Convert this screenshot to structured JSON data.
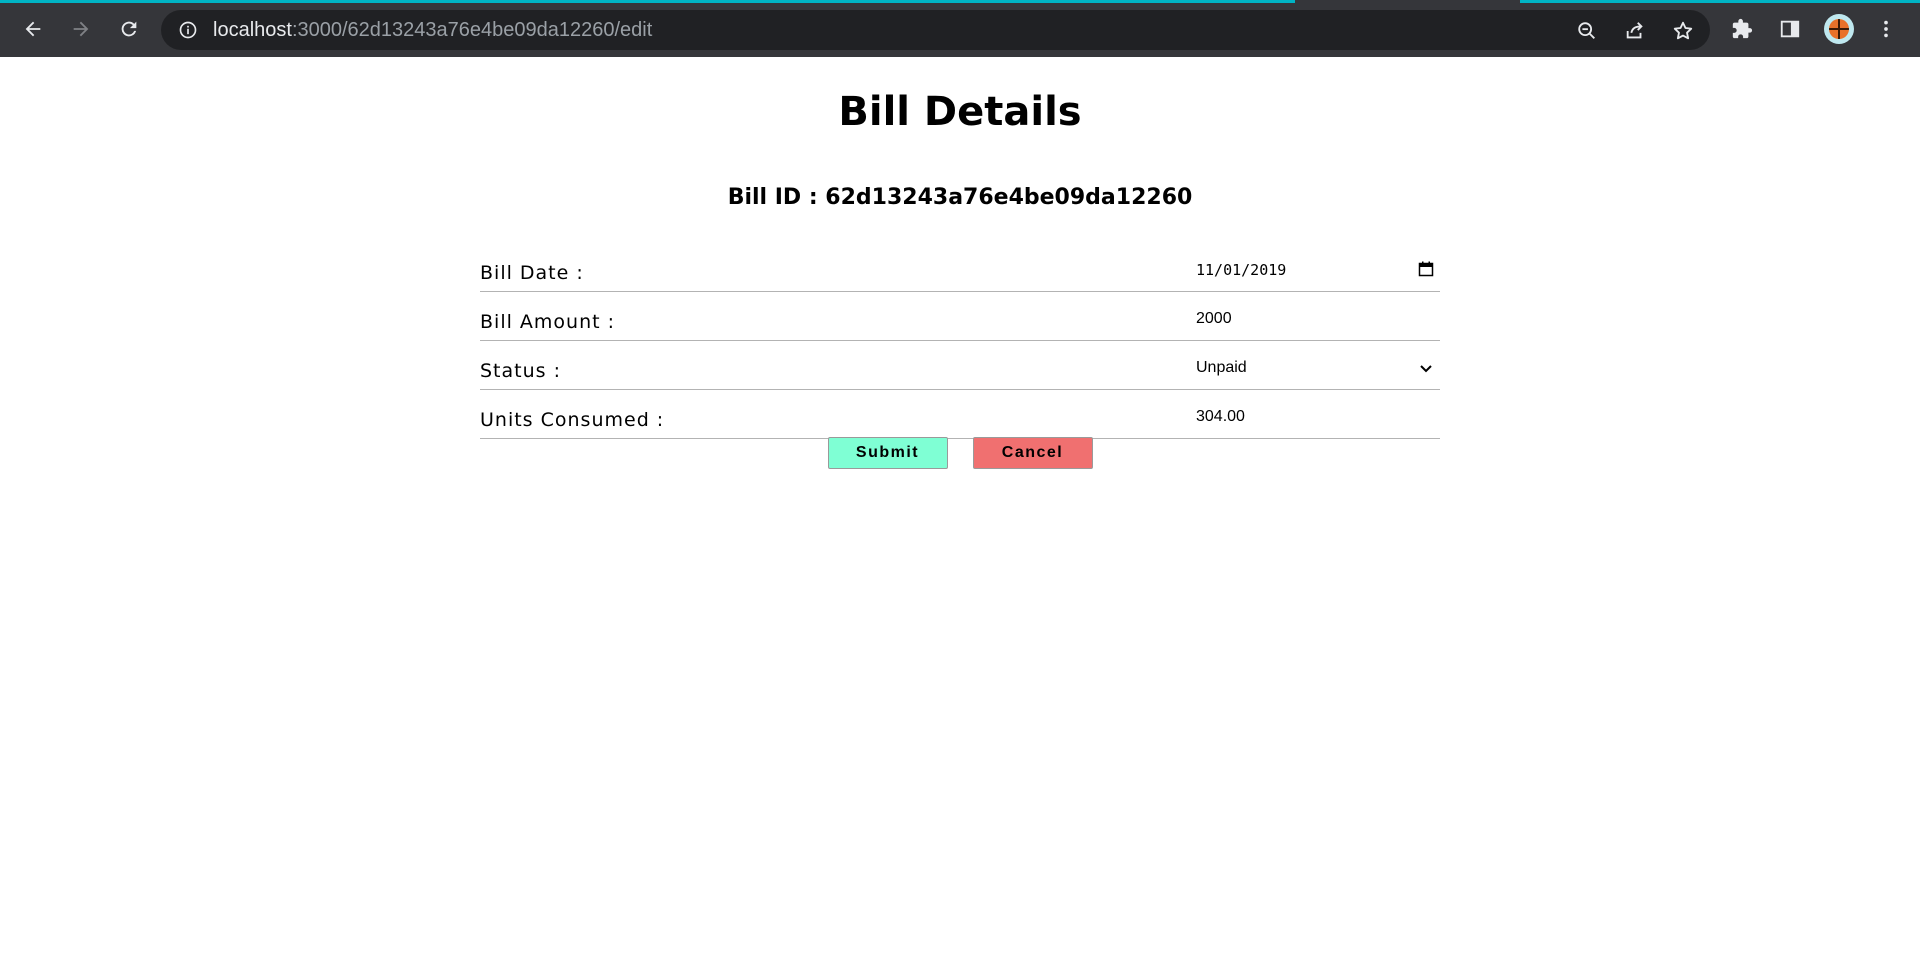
{
  "browser": {
    "url_host": "localhost",
    "url_path": ":3000/62d13243a76e4be09da12260/edit",
    "icons": {
      "back": "back-arrow-icon",
      "forward": "forward-arrow-icon",
      "reload": "reload-icon",
      "site_info": "info-icon",
      "zoom": "zoom-out-icon",
      "share": "share-icon",
      "bookmark": "star-icon",
      "extensions": "puzzle-icon",
      "side_panel": "side-panel-icon",
      "menu": "kebab-menu-icon"
    },
    "colors": {
      "chrome_bg": "#35363a",
      "omnibox_bg": "#202124",
      "loading_bar": "#00b4c4"
    }
  },
  "page": {
    "title": "Bill Details",
    "bill_id_line": "Bill ID : 62d13243a76e4be09da12260",
    "form": {
      "bill_date": {
        "label": "Bill Date :",
        "value": "11/01/2019"
      },
      "bill_amount": {
        "label": "Bill Amount :",
        "value": "2000"
      },
      "status": {
        "label": "Status :",
        "value": "Unpaid"
      },
      "units_consumed": {
        "label": "Units Consumed :",
        "value": "304.00"
      }
    },
    "buttons": {
      "submit": "Submit",
      "cancel": "Cancel"
    },
    "colors": {
      "submit_bg": "#7fffd4",
      "cancel_bg": "#f07070"
    }
  }
}
